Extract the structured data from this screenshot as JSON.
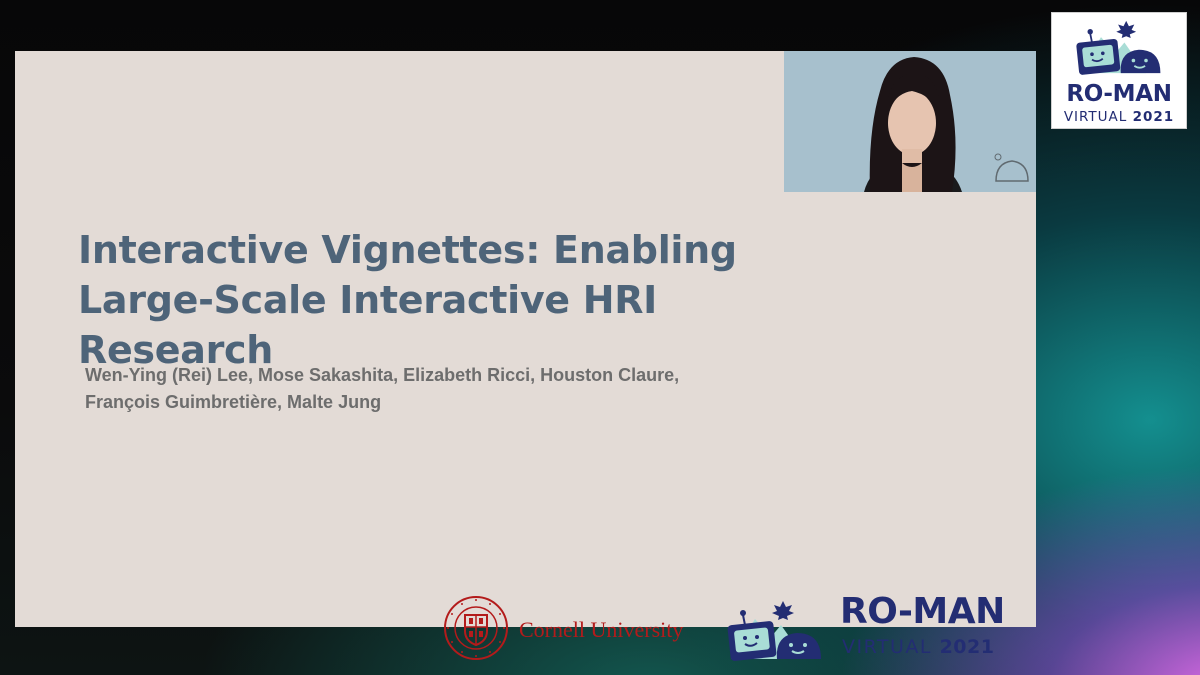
{
  "slide": {
    "title": "Interactive Vignettes: Enabling Large-Scale Interactive HRI Research",
    "authors_line1": "Wen-Ying (Rei) Lee, Mose Sakashita, Elizabeth Ricci, Houston Claure,",
    "authors_line2": "François Guimbretière, Malte Jung"
  },
  "cornell": {
    "name": "Cornell University",
    "seal_text": "CORNELL UNIVERSITY · FOUNDED A.D. 1865"
  },
  "conference": {
    "name": "RO-MAN",
    "virtual_label": "VIRTUAL",
    "year": "2021"
  },
  "colors": {
    "slide_bg": "#e3dbd6",
    "title": "#4e6479",
    "authors": "#6d6d6d",
    "roman_navy": "#232d73",
    "cornell_red": "#b31b1b",
    "mascot_teal": "#a9ddd6"
  }
}
